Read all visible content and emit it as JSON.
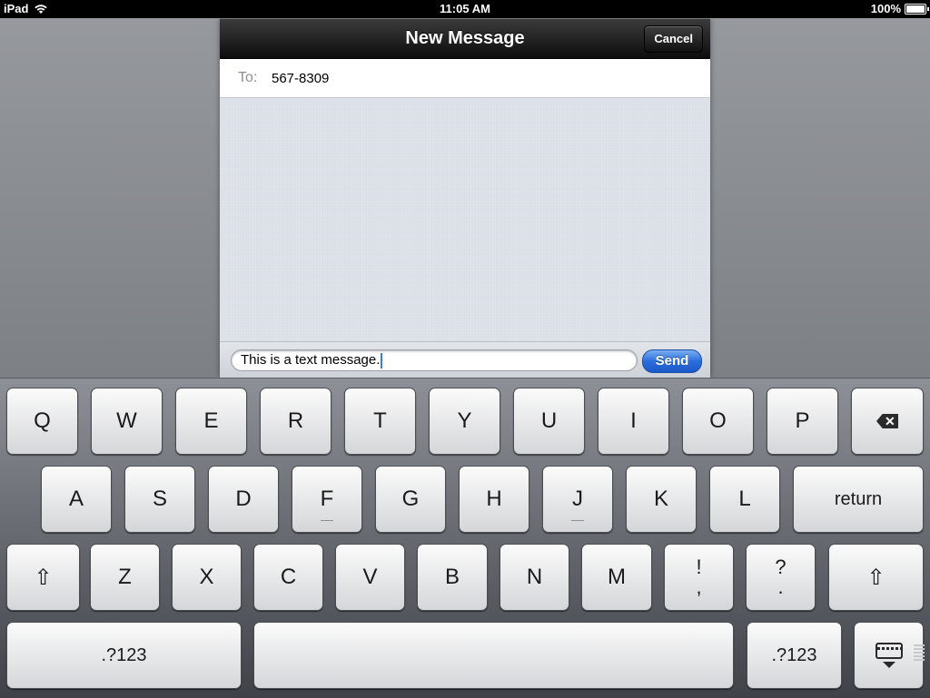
{
  "status_bar": {
    "device": "iPad",
    "time": "11:05 AM",
    "battery": "100%",
    "wifi_icon": "wifi-icon",
    "battery_icon": "battery-icon"
  },
  "sheet": {
    "title": "New Message",
    "cancel_label": "Cancel",
    "to_label": "To:",
    "to_value": "567-8309",
    "message_text": "This is a text message.",
    "send_label": "Send"
  },
  "keyboard": {
    "row1": [
      "Q",
      "W",
      "E",
      "R",
      "T",
      "Y",
      "U",
      "I",
      "O",
      "P"
    ],
    "row2": [
      "A",
      "S",
      "D",
      "F",
      "G",
      "H",
      "J",
      "K",
      "L"
    ],
    "return_label": "return",
    "row3": [
      "Z",
      "X",
      "C",
      "V",
      "B",
      "N",
      "M"
    ],
    "exclaim_top": "!",
    "exclaim_bottom": ",",
    "question_top": "?",
    "question_bottom": ".",
    "numbers_label": ".?123",
    "shift_glyph": "⇧",
    "delete_glyph": "✕"
  },
  "colors": {
    "send_button": "#2b6fdb",
    "navbar": "#1a1a1a",
    "caret": "#3b7bdc"
  }
}
